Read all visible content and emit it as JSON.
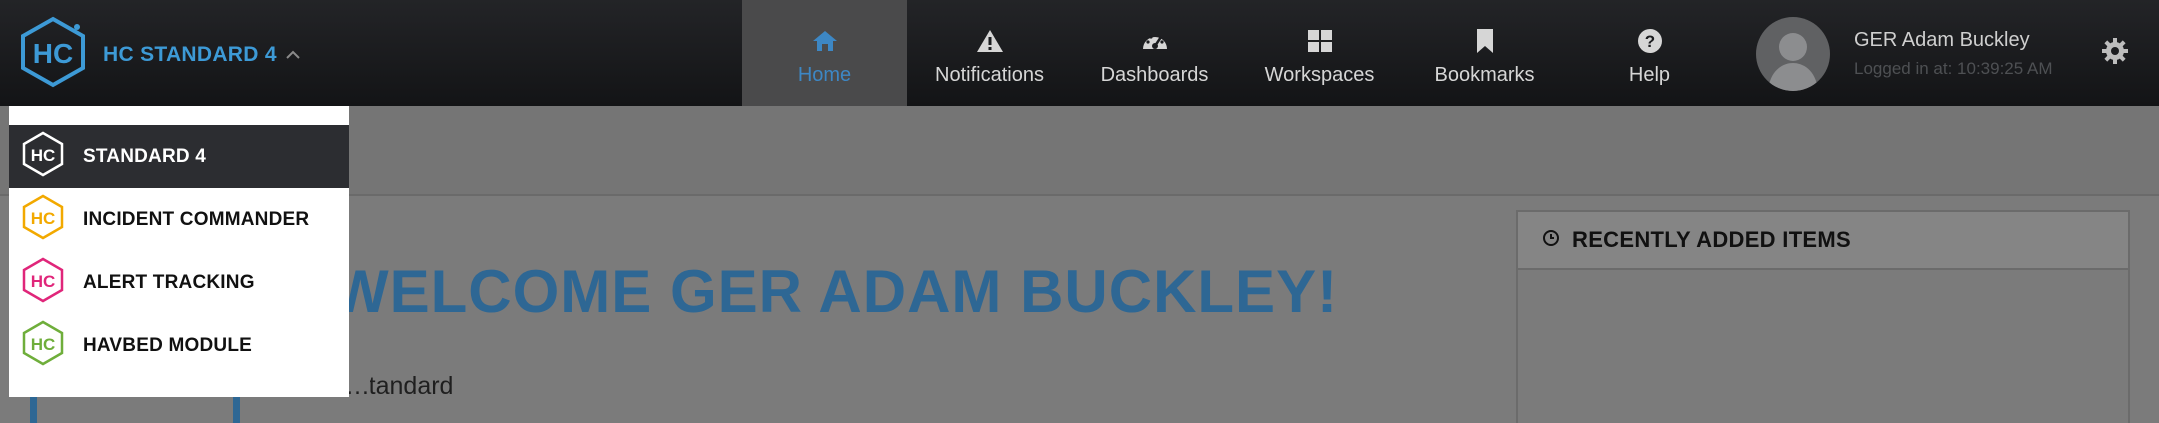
{
  "brand": {
    "title": "HC STANDARD 4",
    "logo_text": "HC"
  },
  "nav": [
    {
      "label": "Home",
      "icon": "home-icon",
      "active": true
    },
    {
      "label": "Notifications",
      "icon": "warning-icon"
    },
    {
      "label": "Dashboards",
      "icon": "dashboard-icon"
    },
    {
      "label": "Workspaces",
      "icon": "grid-icon"
    },
    {
      "label": "Bookmarks",
      "icon": "bookmark-icon"
    },
    {
      "label": "Help",
      "icon": "help-icon"
    }
  ],
  "user": {
    "name": "GER Adam Buckley",
    "login": "Logged in at: 10:39:25 AM"
  },
  "page": {
    "welcome": "WELCOME GER ADAM BUCKLEY!",
    "subtitle": "Standard"
  },
  "panel": {
    "title": "RECENTLY ADDED ITEMS"
  },
  "dropdown": {
    "items": [
      {
        "label": "STANDARD 4",
        "color": "#ffffff",
        "selected": true
      },
      {
        "label": "INCIDENT COMMANDER",
        "color": "#f2a900"
      },
      {
        "label": "ALERT TRACKING",
        "color": "#e0267a"
      },
      {
        "label": "HAVBED MODULE",
        "color": "#6fae3b"
      }
    ]
  },
  "colors": {
    "accent": "#3d9ad6",
    "topbar": "#1b1c1f",
    "active_tab": "#4a4a4b"
  }
}
